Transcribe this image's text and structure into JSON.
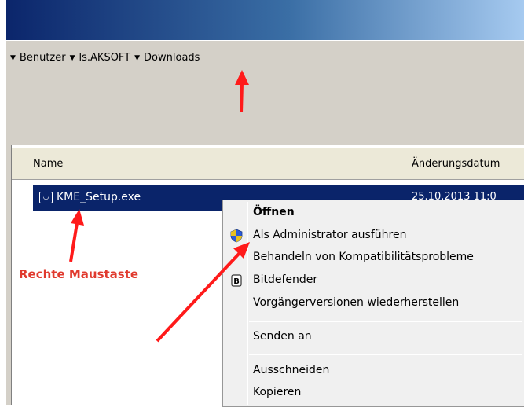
{
  "breadcrumb": {
    "items": [
      "Benutzer",
      "ls.AKSOFT",
      "Downloads"
    ],
    "separator_glyph": "▼"
  },
  "columns": {
    "name": "Name",
    "date": "Änderungsdatum"
  },
  "file": {
    "name": "KME_Setup.exe",
    "date": "25.10.2013 11:0",
    "icon": "setup-exe-icon"
  },
  "context_menu": {
    "items": [
      {
        "label": "Öffnen",
        "bold": true
      },
      {
        "label": "Als Administrator ausführen",
        "icon": "uac-shield-icon"
      },
      {
        "label": "Behandeln von Kompatibilitätsprobleme"
      },
      {
        "label": "Bitdefender",
        "icon": "bitdefender-icon"
      },
      {
        "label": "Vorgängerversionen wiederherstellen"
      },
      {
        "label": "Senden an"
      },
      {
        "label": "Ausschneiden"
      },
      {
        "label": "Kopieren"
      }
    ]
  },
  "annotation": {
    "text": "Rechte Maustaste",
    "color": "#e03a2e"
  },
  "colors": {
    "selection": "#0a246a",
    "titlebar": "#0a246a",
    "chrome": "#d4d0c8",
    "arrow": "#ff1a1a"
  }
}
